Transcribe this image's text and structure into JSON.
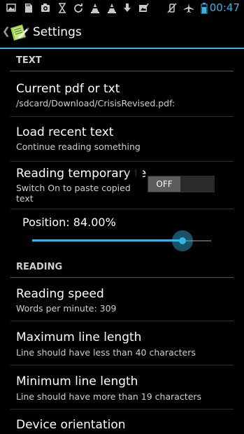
{
  "status_bar": {
    "time": "00:47",
    "icons": [
      "image-icon",
      "sd-card-icon",
      "camera-icon",
      "hourglass-icon",
      "sync-icon",
      "traffic-cone-icon",
      "download-icon",
      "photo-check-icon",
      "vibrate-off-icon",
      "airplane-icon",
      "battery-icon"
    ]
  },
  "action_bar": {
    "title": "Settings"
  },
  "sections": {
    "text": "TEXT",
    "reading": "READING"
  },
  "prefs": {
    "current": {
      "title": "Current pdf or txt",
      "summary": "/sdcard/Download/CrisisRevised.pdf:"
    },
    "recent": {
      "title": "Load recent text",
      "summary": "Continue reading something"
    },
    "temporary": {
      "title": "Reading temporary te",
      "summary_line1": "Switch On to paste copied",
      "summary_line2": "text",
      "toggle_label": "OFF"
    },
    "position": {
      "label": "Position: 84.00%",
      "value": 0.84
    },
    "speed": {
      "title": "Reading speed",
      "summary": "Words per minute: 309"
    },
    "max_line": {
      "title": "Maximum line length",
      "summary": "Line should have less than 40 characters"
    },
    "min_line": {
      "title": "Minimum line length",
      "summary": "Line should have more than 19 characters"
    },
    "orientation": {
      "title": "Device orientation"
    }
  },
  "colors": {
    "accent": "#33b5e5",
    "background": "#000000"
  }
}
